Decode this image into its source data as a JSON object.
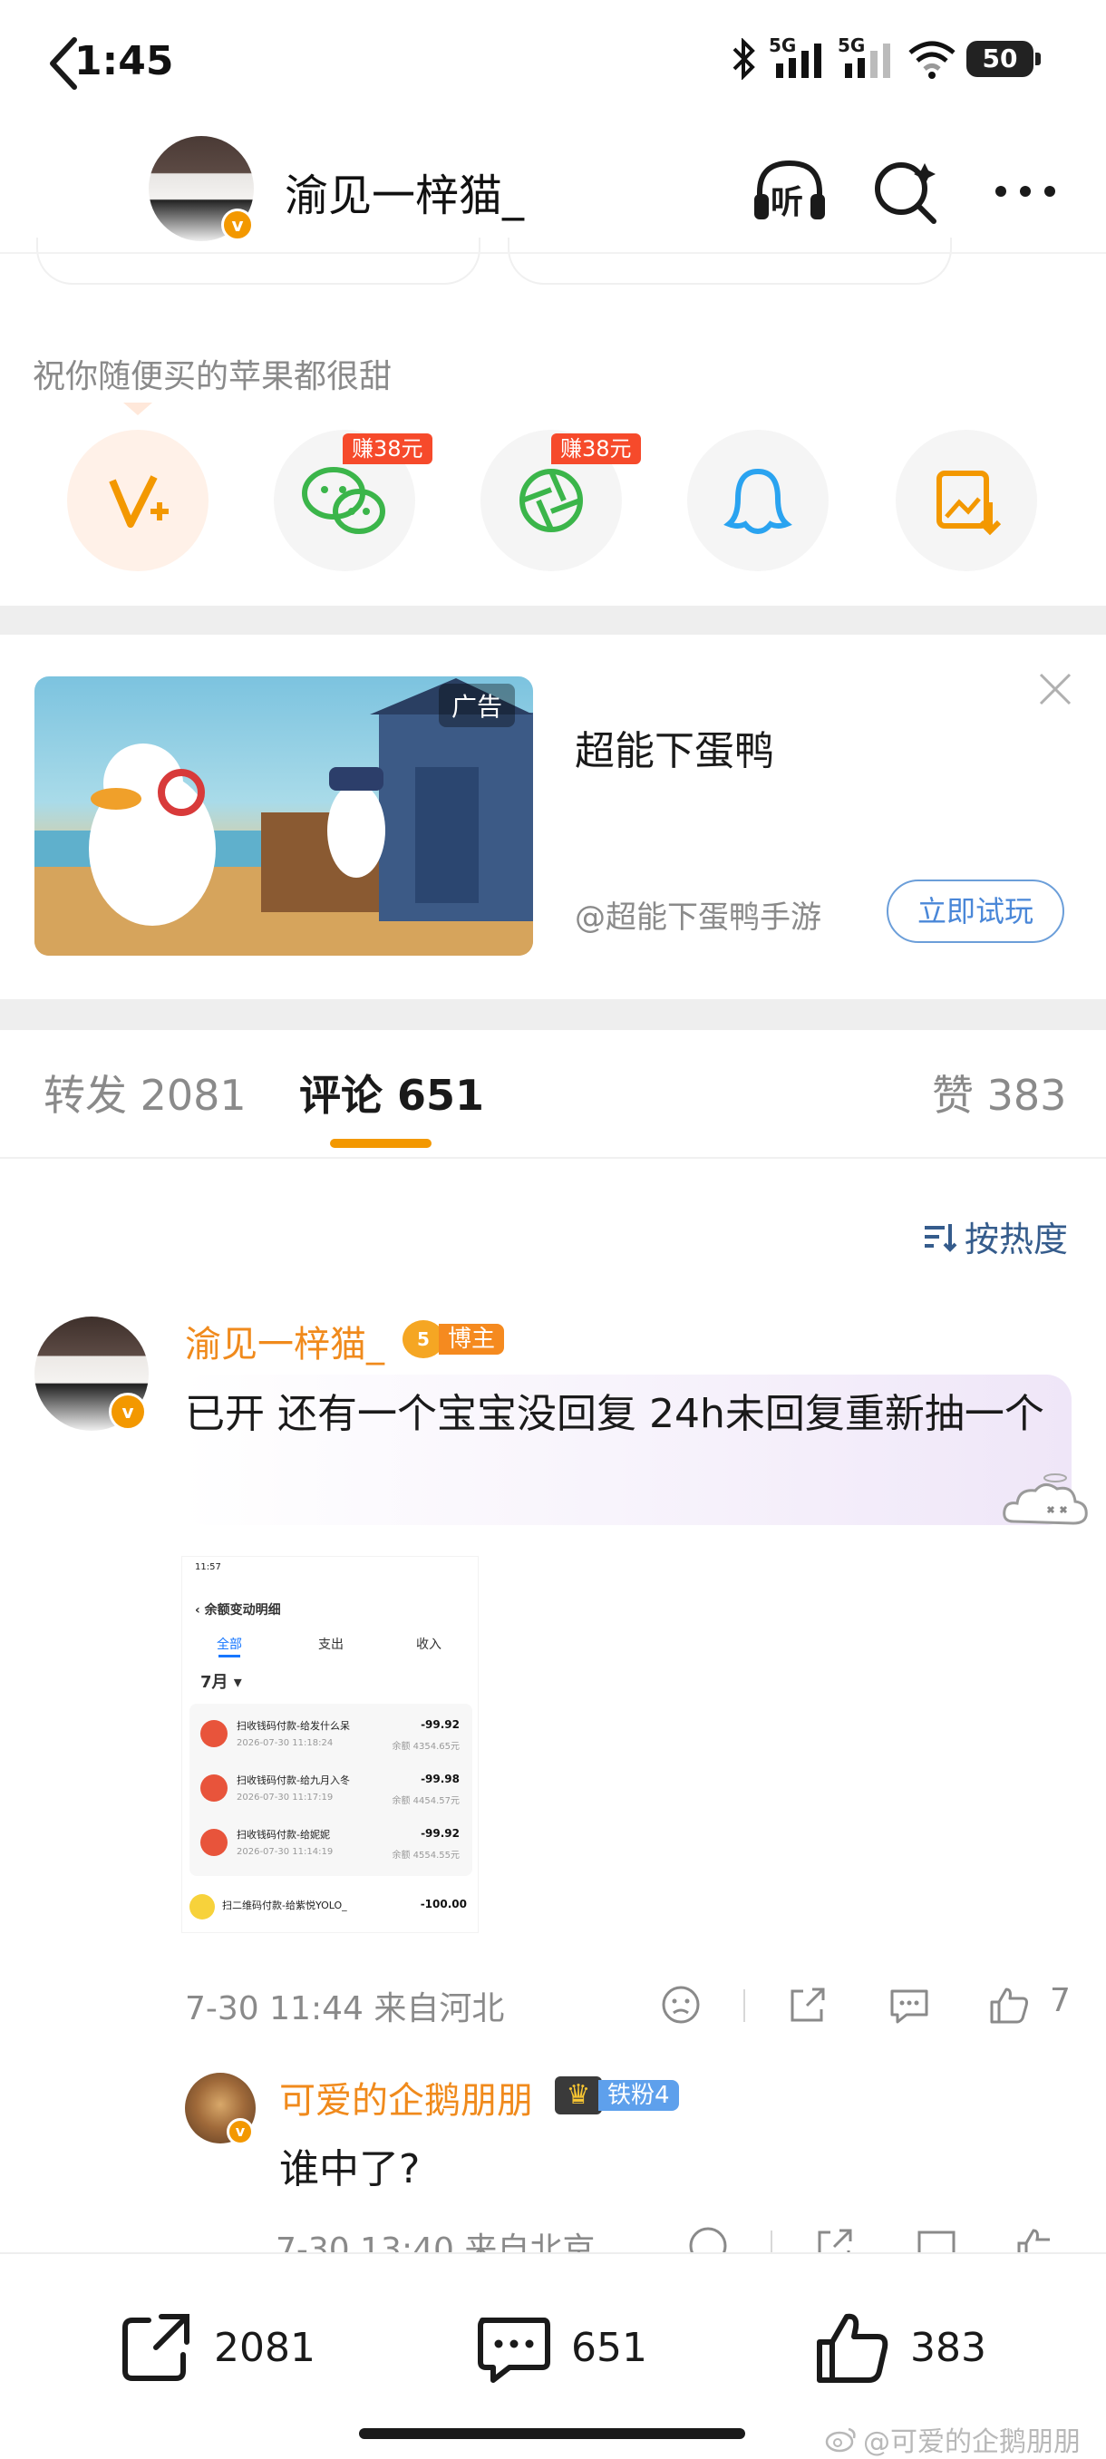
{
  "status_bar": {
    "time": "1:45",
    "network_1": "5G",
    "network_2": "5G",
    "battery": "50"
  },
  "nav": {
    "title": "渝见一梓猫_",
    "listen_label": "听"
  },
  "share_panel": {
    "message": "祝你随便买的苹果都很甜",
    "wechat_reward": "赚38元",
    "moments_reward": "赚38元"
  },
  "ad": {
    "tag": "广告",
    "title": "超能下蛋鸭",
    "source": "@超能下蛋鸭手游",
    "button": "立即试玩"
  },
  "tabs": {
    "repost_label": "转发",
    "repost_count": "2081",
    "comment_label": "评论",
    "comment_count": "651",
    "like_label": "赞",
    "like_count": "383"
  },
  "sort": {
    "label": "按热度"
  },
  "comment": {
    "author": "渝见一梓猫_",
    "level": "5",
    "role_badge": "博主",
    "text": "已开 还有一个宝宝没回复 24h未回复重新抽一个",
    "meta": "7-30 11:44  来自河北",
    "like_count": "7"
  },
  "screenshot": {
    "status_time": "11:57",
    "header": "余额变动明细",
    "tabs": [
      "全部",
      "支出",
      "收入"
    ],
    "month": "7月",
    "rows": [
      {
        "title": "扫收钱码付款-给发什么呆",
        "date": "2026-07-30 11:18:24",
        "amount": "-99.92",
        "balance": "余额 4354.65元"
      },
      {
        "title": "扫收钱码付款-给九月入冬",
        "date": "2026-07-30 11:17:19",
        "amount": "-99.98",
        "balance": "余额 4454.57元"
      },
      {
        "title": "扫收钱码付款-给妮妮",
        "date": "2026-07-30 11:14:19",
        "amount": "-99.92",
        "balance": "余额 4554.55元"
      }
    ],
    "last_row": {
      "title": "扫二维码付款-给紫悦YOLO_",
      "amount": "-100.00"
    }
  },
  "reply": {
    "author": "可爱的企鹅朋朋",
    "fan_badge": "铁粉4",
    "text": "谁中了?",
    "meta": "7-30 13:40  来自北京"
  },
  "bottom_bar": {
    "repost_count": "2081",
    "comment_count": "651",
    "like_count": "383"
  },
  "watermark": "@可爱的企鹅朋朋",
  "colors": {
    "accent_orange": "#f39800",
    "name_orange": "#f08a1c",
    "link_blue": "#355c8c",
    "earn_red": "#f64a2b"
  }
}
